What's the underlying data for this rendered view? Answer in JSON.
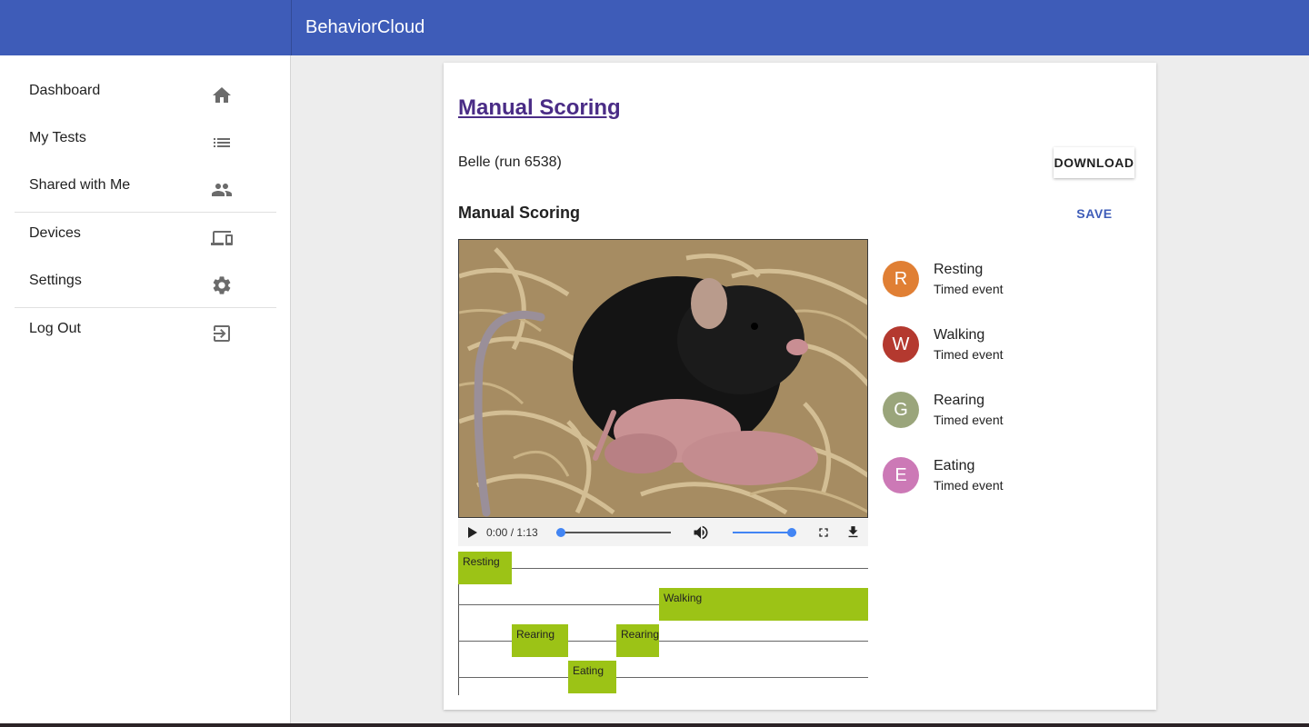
{
  "app": {
    "title": "BehaviorCloud"
  },
  "sidebar": {
    "items": [
      {
        "label": "Dashboard",
        "icon": "home-icon"
      },
      {
        "label": "My Tests",
        "icon": "list-icon"
      },
      {
        "label": "Shared with Me",
        "icon": "people-icon"
      },
      {
        "label": "Devices",
        "icon": "devices-icon"
      },
      {
        "label": "Settings",
        "icon": "gear-icon"
      },
      {
        "label": "Log Out",
        "icon": "exit-icon"
      }
    ]
  },
  "main": {
    "page_link": "Manual Scoring",
    "subject": "Belle (run 6538)",
    "download_label": "DOWNLOAD",
    "section_title": "Manual Scoring",
    "save_label": "SAVE",
    "video": {
      "time": "0:00 / 1:13",
      "progress": 0.0,
      "volume": 1.0
    },
    "events": [
      {
        "initial": "R",
        "name": "Resting",
        "type": "Timed event",
        "color": "#e07f34"
      },
      {
        "initial": "W",
        "name": "Walking",
        "type": "Timed event",
        "color": "#b4392f"
      },
      {
        "initial": "G",
        "name": "Rearing",
        "type": "Timed event",
        "color": "#9aa57b"
      },
      {
        "initial": "E",
        "name": "Eating",
        "type": "Timed event",
        "color": "#cc79b6"
      }
    ],
    "timeline": {
      "color": "#9cc316",
      "labels": [
        "Resting",
        "Walking",
        "Rearing",
        "Rearing",
        "Eating"
      ]
    }
  }
}
